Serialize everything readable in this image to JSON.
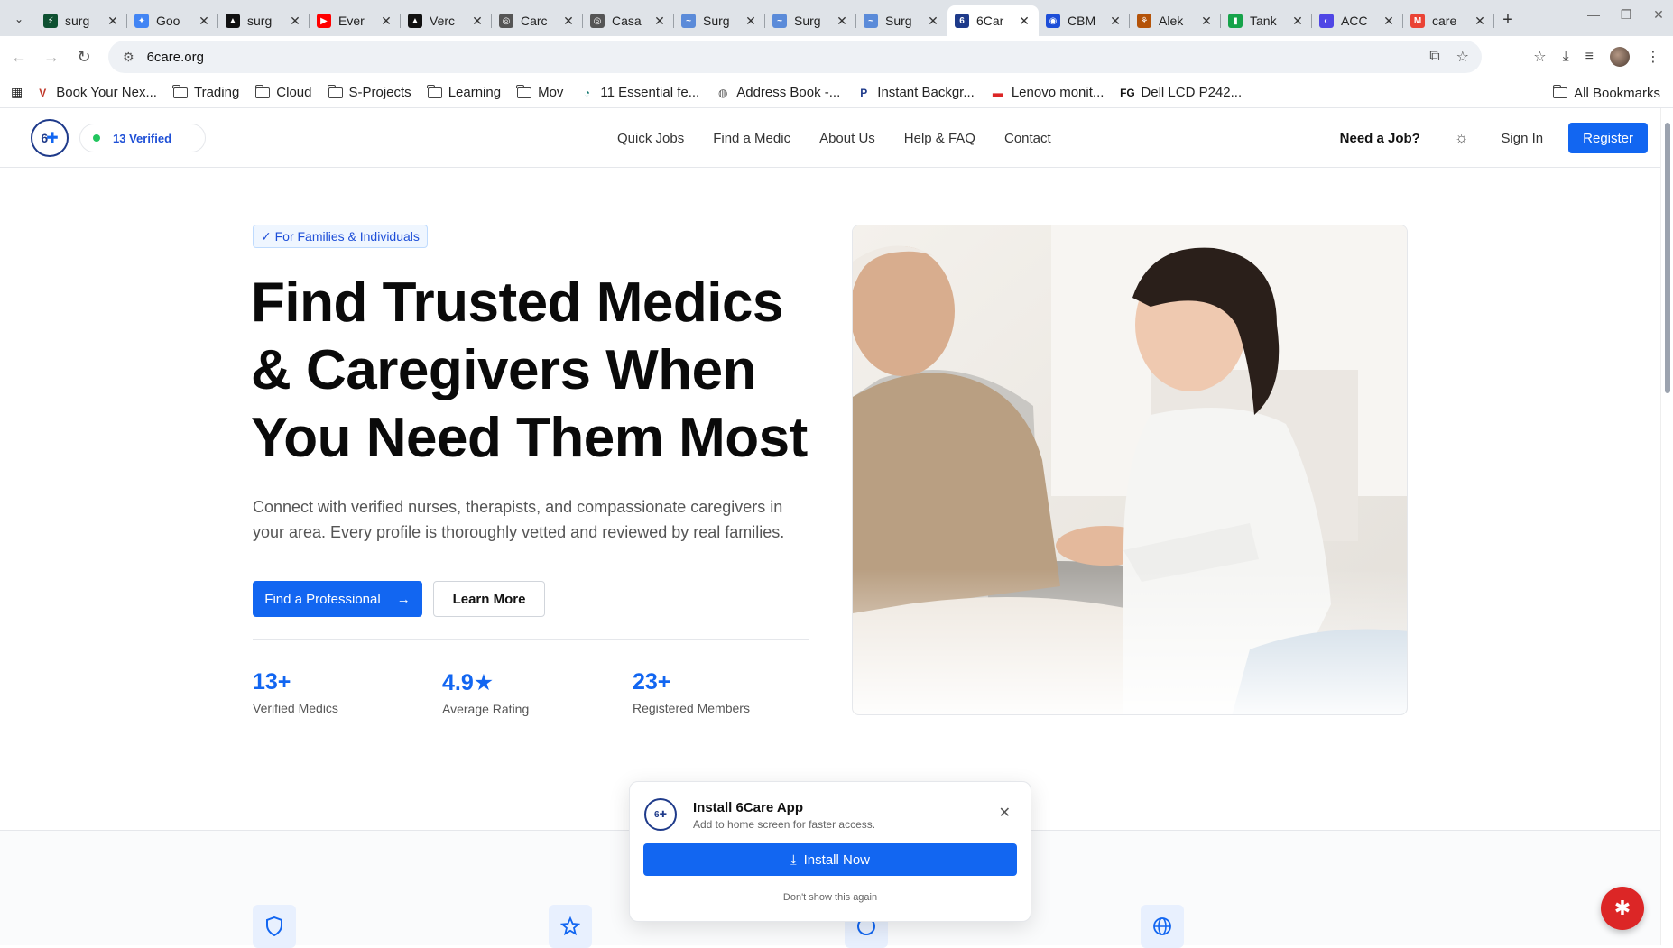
{
  "browser": {
    "tabs": [
      {
        "title": "surg",
        "color": "#0f5132",
        "glyph": "⚡"
      },
      {
        "title": "Goo",
        "color": "#4285f4",
        "glyph": "✦"
      },
      {
        "title": "surg",
        "color": "#111111",
        "glyph": "▲"
      },
      {
        "title": "Ever",
        "color": "#ff0000",
        "glyph": "▶"
      },
      {
        "title": "Verc",
        "color": "#111111",
        "glyph": "▲"
      },
      {
        "title": "Carc",
        "color": "#555555",
        "glyph": "◎"
      },
      {
        "title": "Casa",
        "color": "#555555",
        "glyph": "◎"
      },
      {
        "title": "Surg",
        "color": "#5b8bd9",
        "glyph": "~"
      },
      {
        "title": "Surg",
        "color": "#5b8bd9",
        "glyph": "~"
      },
      {
        "title": "Surg",
        "color": "#5b8bd9",
        "glyph": "~"
      },
      {
        "title": "6Car",
        "color": "#1e3a8a",
        "glyph": "6",
        "active": true
      },
      {
        "title": "CBM",
        "color": "#1d4ed8",
        "glyph": "◉"
      },
      {
        "title": "Alek",
        "color": "#b45309",
        "glyph": "⚘"
      },
      {
        "title": "Tank",
        "color": "#16a34a",
        "glyph": "▮"
      },
      {
        "title": "ACC",
        "color": "#4f46e5",
        "glyph": "◐"
      },
      {
        "title": "care",
        "color": "#ea4335",
        "glyph": "M"
      }
    ],
    "url": "6care.org",
    "bookmarks": [
      {
        "label": "Book Your Nex...",
        "type": "link",
        "icon": "v-icon"
      },
      {
        "label": "Trading",
        "type": "folder"
      },
      {
        "label": "Cloud",
        "type": "folder"
      },
      {
        "label": "S-Projects",
        "type": "folder"
      },
      {
        "label": "Learning",
        "type": "folder"
      },
      {
        "label": "Mov",
        "type": "folder"
      },
      {
        "label": "11 Essential fe...",
        "type": "link",
        "icon": "c-icon"
      },
      {
        "label": "Address Book -...",
        "type": "link",
        "icon": "globe-icon"
      },
      {
        "label": "Instant Backgr...",
        "type": "link",
        "icon": "p-icon"
      },
      {
        "label": "Lenovo monit...",
        "type": "link",
        "icon": "lenovo-icon"
      },
      {
        "label": "Dell LCD P242...",
        "type": "link",
        "icon": "fg-icon"
      }
    ],
    "all_bookmarks": "All Bookmarks"
  },
  "site": {
    "logo_text": "6",
    "verified_badge": "13 Verified",
    "nav": [
      "Quick Jobs",
      "Find a Medic",
      "About Us",
      "Help & FAQ",
      "Contact"
    ],
    "need_job": "Need a Job?",
    "sign_in": "Sign In",
    "register": "Register"
  },
  "hero": {
    "chip": "✓ For Families & Individuals",
    "title": "Find Trusted Medics & Caregivers When You Need Them Most",
    "subtitle": "Connect with verified nurses, therapists, and compassionate caregivers in your area. Every profile is thoroughly vetted and reviewed by real families.",
    "primary_button": "Find a Professional",
    "secondary_button": "Learn More",
    "stats": [
      {
        "value": "13+",
        "label": "Verified Medics"
      },
      {
        "value": "4.9★",
        "label": "Average Rating"
      },
      {
        "value": "23+",
        "label": "Registered Members"
      }
    ]
  },
  "popup": {
    "title": "Install 6Care App",
    "subtitle": "Add to home screen for faster access.",
    "install_button": "Install Now",
    "dismiss": "Don't show this again"
  },
  "colors": {
    "accent": "#1266f1",
    "verified_dot": "#22c55e",
    "fab": "#dc2626"
  }
}
